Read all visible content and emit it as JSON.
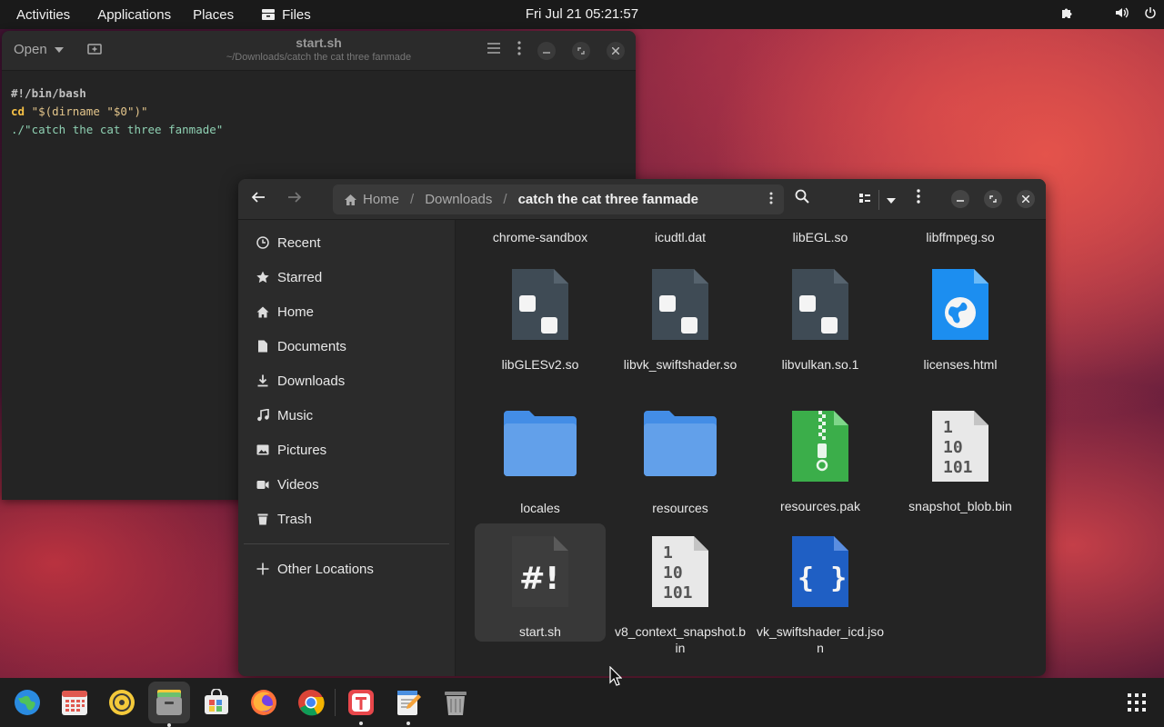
{
  "topbar": {
    "activities": "Activities",
    "applications": "Applications",
    "places": "Places",
    "files_app": "Files",
    "datetime": "Fri Jul 21  05:21:57",
    "icons": [
      "puzzle-icon",
      "volume-icon",
      "power-icon"
    ]
  },
  "editor": {
    "open_label": "Open",
    "title": "start.sh",
    "subtitle": "~/Downloads/catch the cat three fanmade",
    "code": {
      "line1": "#!/bin/bash",
      "line2_kw": "cd",
      "line2_rest": "\"$(dirname \"$0\")\"",
      "line3": "./\"catch the cat three fanmade\""
    }
  },
  "files": {
    "pathbar": {
      "home": "Home",
      "sep": "/",
      "downloads": "Downloads",
      "current": "catch the cat three fanmade"
    },
    "sidebar": [
      {
        "label": "Recent",
        "icon": "clock-icon"
      },
      {
        "label": "Starred",
        "icon": "star-icon"
      },
      {
        "label": "Home",
        "icon": "home-icon"
      },
      {
        "label": "Documents",
        "icon": "document-icon"
      },
      {
        "label": "Downloads",
        "icon": "download-icon"
      },
      {
        "label": "Music",
        "icon": "music-icon"
      },
      {
        "label": "Pictures",
        "icon": "picture-icon"
      },
      {
        "label": "Videos",
        "icon": "video-icon"
      },
      {
        "label": "Trash",
        "icon": "trash-icon"
      }
    ],
    "other_locations": "Other Locations",
    "items": [
      {
        "name": "chrome-sandbox",
        "type": "partial"
      },
      {
        "name": "icudtl.dat",
        "type": "partial"
      },
      {
        "name": "libEGL.so",
        "type": "partial"
      },
      {
        "name": "libffmpeg.so",
        "type": "partial"
      },
      {
        "name": "libGLESv2.so",
        "type": "library"
      },
      {
        "name": "libvk_swiftshader.so",
        "type": "library"
      },
      {
        "name": "libvulkan.so.1",
        "type": "library"
      },
      {
        "name": "licenses.html",
        "type": "html"
      },
      {
        "name": "locales",
        "type": "folder"
      },
      {
        "name": "resources",
        "type": "folder"
      },
      {
        "name": "resources.pak",
        "type": "archive"
      },
      {
        "name": "snapshot_blob.bin",
        "type": "binary"
      },
      {
        "name": "start.sh",
        "type": "script",
        "selected": true
      },
      {
        "name": "v8_context_snapshot.bin",
        "type": "binary"
      },
      {
        "name": "vk_swiftshader_icd.json",
        "type": "json"
      }
    ],
    "glyphs": {
      "script": "#!",
      "json": "{ }",
      "bin1": "1",
      "bin2": "10",
      "bin3": "101"
    }
  },
  "dock": {
    "apps": [
      "globe-icon",
      "calendar-icon",
      "music-player-icon",
      "files-icon",
      "software-store-icon",
      "firefox-icon",
      "chrome-icon",
      "typora-icon",
      "text-editor-icon",
      "trash-icon",
      "app-grid-icon"
    ]
  }
}
